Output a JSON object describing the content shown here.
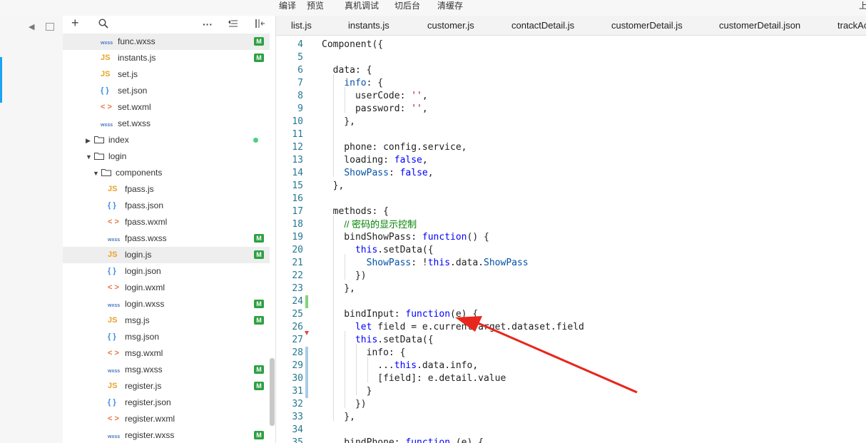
{
  "toolbar": {
    "compile": "编译",
    "preview": "预览",
    "remote_debug": "真机调试",
    "background": "切后台",
    "clear_cache": "清缓存",
    "upload": "上"
  },
  "explorer": {
    "icons": [
      "sound-icon",
      "window-icon",
      "plus-icon",
      "search-icon",
      "more-icon",
      "collapse-all-icon",
      "split-icon"
    ],
    "items": [
      {
        "name": "func.wxss",
        "type": "wxss",
        "badge": "M",
        "selected": true
      },
      {
        "name": "instants.js",
        "type": "js",
        "badge": "M"
      },
      {
        "name": "set.js",
        "type": "js"
      },
      {
        "name": "set.json",
        "type": "json"
      },
      {
        "name": "set.wxml",
        "type": "wxml"
      },
      {
        "name": "set.wxss",
        "type": "wxss"
      },
      {
        "name": "index",
        "type": "folder-closed",
        "dot": true
      },
      {
        "name": "login",
        "type": "folder-open"
      },
      {
        "name": "components",
        "type": "folder-open"
      },
      {
        "name": "fpass.js",
        "type": "js"
      },
      {
        "name": "fpass.json",
        "type": "json"
      },
      {
        "name": "fpass.wxml",
        "type": "wxml"
      },
      {
        "name": "fpass.wxss",
        "type": "wxss",
        "badge": "M"
      },
      {
        "name": "login.js",
        "type": "js",
        "badge": "M",
        "selected": true
      },
      {
        "name": "login.json",
        "type": "json"
      },
      {
        "name": "login.wxml",
        "type": "wxml"
      },
      {
        "name": "login.wxss",
        "type": "wxss",
        "badge": "M"
      },
      {
        "name": "msg.js",
        "type": "js",
        "badge": "M"
      },
      {
        "name": "msg.json",
        "type": "json"
      },
      {
        "name": "msg.wxml",
        "type": "wxml"
      },
      {
        "name": "msg.wxss",
        "type": "wxss",
        "badge": "M"
      },
      {
        "name": "register.js",
        "type": "js",
        "badge": "M"
      },
      {
        "name": "register.json",
        "type": "json"
      },
      {
        "name": "register.wxml",
        "type": "wxml"
      },
      {
        "name": "register.wxss",
        "type": "wxss",
        "badge": "M"
      }
    ]
  },
  "icon_text": {
    "js": "JS",
    "json": "{ }",
    "wxml": "< >",
    "wxss": "wxss",
    "folder-closed": "▶",
    "folder-open": "▼"
  },
  "tabs": [
    "list.js",
    "instants.js",
    "customer.js",
    "contactDetail.js",
    "customerDetail.js",
    "customerDetail.json",
    "trackAc"
  ],
  "editor": {
    "lines": [
      {
        "n": 4,
        "html": "Component({"
      },
      {
        "n": 5,
        "html": ""
      },
      {
        "n": 6,
        "html": "  data: {"
      },
      {
        "n": 7,
        "html": "    <span class='prop'>info</span>: {"
      },
      {
        "n": 8,
        "html": "      userCode: <span class='str'>''</span>,"
      },
      {
        "n": 9,
        "html": "      password: <span class='str'>''</span>,"
      },
      {
        "n": 10,
        "html": "    },"
      },
      {
        "n": 11,
        "html": ""
      },
      {
        "n": 12,
        "html": "    phone: config.service,"
      },
      {
        "n": 13,
        "html": "    loading: <span class='kw'>false</span>,"
      },
      {
        "n": 14,
        "html": "    <span class='prop'>ShowPass</span>: <span class='kw'>false</span>,"
      },
      {
        "n": 15,
        "html": "  },"
      },
      {
        "n": 16,
        "html": ""
      },
      {
        "n": 17,
        "html": "  methods: {"
      },
      {
        "n": 18,
        "html": "    <span class='cmt'>// 密码的显示控制</span>"
      },
      {
        "n": 19,
        "html": "    bindShowPass: <span class='kw'>function</span>() {"
      },
      {
        "n": 20,
        "html": "      <span class='kw'>this</span>.setData({"
      },
      {
        "n": 21,
        "html": "        <span class='prop'>ShowPass</span>: !<span class='kw'>this</span>.data.<span class='prop'>ShowPass</span>"
      },
      {
        "n": 22,
        "html": "      })"
      },
      {
        "n": 23,
        "html": "    },"
      },
      {
        "n": 24,
        "html": ""
      },
      {
        "n": 25,
        "html": "    bindInput: <span class='kw'>function</span>(e) {"
      },
      {
        "n": 26,
        "html": "      <span class='kw'>let</span> field = e.currentTarget.dataset.field"
      },
      {
        "n": 27,
        "html": "      <span class='kw'>this</span>.setData({"
      },
      {
        "n": 28,
        "html": "        info: {"
      },
      {
        "n": 29,
        "html": "          ...<span class='kw'>this</span>.data.info,"
      },
      {
        "n": 30,
        "html": "          [field]: e.detail.value"
      },
      {
        "n": 31,
        "html": "        }"
      },
      {
        "n": 32,
        "html": "      })"
      },
      {
        "n": 33,
        "html": "    },"
      },
      {
        "n": 34,
        "html": ""
      },
      {
        "n": 35,
        "html": "    bindPhone: <span class='kw'>function</span> (e) {"
      }
    ]
  },
  "annotation": {
    "color": "#e8261c"
  }
}
